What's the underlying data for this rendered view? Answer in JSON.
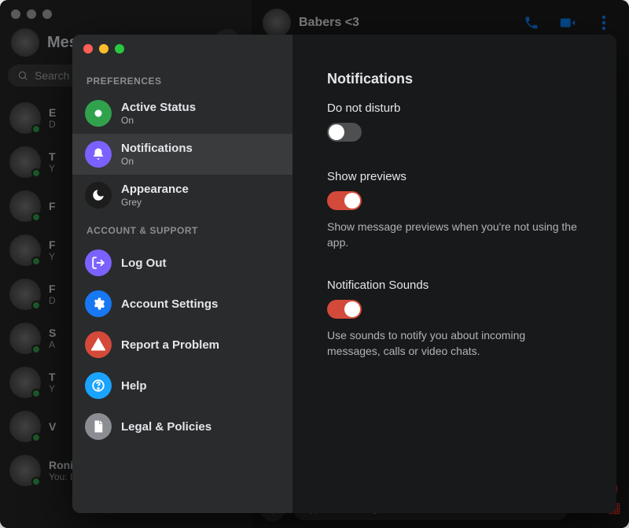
{
  "app": {
    "title": "Messenger",
    "search_placeholder": "Search"
  },
  "header": {
    "conversation_title": "Babers <3"
  },
  "composer": {
    "placeholder": "Type a message..."
  },
  "chats": [
    {
      "name": "E",
      "sub": "D"
    },
    {
      "name": "T",
      "sub": "Y"
    },
    {
      "name": "F",
      "sub": ""
    },
    {
      "name": "F",
      "sub": "Y"
    },
    {
      "name": "F",
      "sub": "D"
    },
    {
      "name": "S",
      "sub": "A"
    },
    {
      "name": "T",
      "sub": "Y"
    },
    {
      "name": "V",
      "sub": ""
    },
    {
      "name": "Roni Myrick",
      "sub": "You: I love you and mis…  · Wed"
    }
  ],
  "dialog": {
    "sections": {
      "preferences": "PREFERENCES",
      "account": "ACCOUNT & SUPPORT"
    },
    "nav": {
      "active_status": {
        "label": "Active Status",
        "sub": "On",
        "color": "#31a24c"
      },
      "notifications": {
        "label": "Notifications",
        "sub": "On",
        "color": "#7b61ff"
      },
      "appearance": {
        "label": "Appearance",
        "sub": "Grey",
        "color": "#1c1c1c"
      },
      "log_out": {
        "label": "Log Out",
        "color": "#7b61ff"
      },
      "account_settings": {
        "label": "Account Settings",
        "color": "#1877f2"
      },
      "report": {
        "label": "Report a Problem",
        "color": "#d44a3a"
      },
      "help": {
        "label": "Help",
        "color": "#1aa3ff"
      },
      "legal": {
        "label": "Legal & Policies",
        "color": "#8a8d91"
      }
    },
    "content": {
      "title": "Notifications",
      "dnd": {
        "label": "Do not disturb",
        "value": false
      },
      "previews": {
        "label": "Show previews",
        "value": true,
        "desc": "Show message previews when you're not using the app."
      },
      "sounds": {
        "label": "Notification Sounds",
        "value": true,
        "desc": "Use sounds to notify you about incoming messages, calls or video chats."
      }
    }
  }
}
